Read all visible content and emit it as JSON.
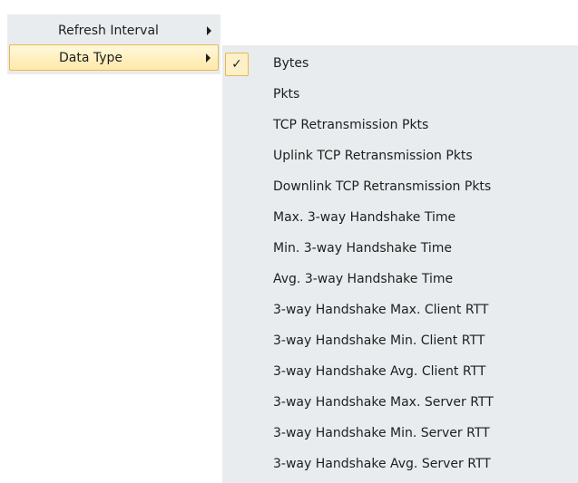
{
  "main_menu": {
    "items": [
      {
        "label": "Refresh Interval",
        "has_submenu": true,
        "highlighted": false
      },
      {
        "label": "Data Type",
        "has_submenu": true,
        "highlighted": true
      }
    ]
  },
  "data_type_menu": {
    "check_glyph": "✓",
    "selected": "Bytes",
    "items": [
      {
        "label": "Bytes",
        "checked": true
      },
      {
        "label": "Pkts",
        "checked": false
      },
      {
        "label": "TCP Retransmission Pkts",
        "checked": false
      },
      {
        "label": "Uplink TCP Retransmission Pkts",
        "checked": false
      },
      {
        "label": "Downlink TCP Retransmission Pkts",
        "checked": false
      },
      {
        "label": "Max. 3-way Handshake Time",
        "checked": false
      },
      {
        "label": "Min. 3-way Handshake Time",
        "checked": false
      },
      {
        "label": "Avg. 3-way Handshake Time",
        "checked": false
      },
      {
        "label": "3-way Handshake Max. Client RTT",
        "checked": false
      },
      {
        "label": "3-way Handshake Min. Client RTT",
        "checked": false
      },
      {
        "label": "3-way Handshake Avg. Client RTT",
        "checked": false
      },
      {
        "label": "3-way Handshake Max. Server RTT",
        "checked": false
      },
      {
        "label": "3-way Handshake Min. Server RTT",
        "checked": false
      },
      {
        "label": "3-way Handshake Avg. Server RTT",
        "checked": false
      }
    ]
  },
  "colors": {
    "menu_background": "#e9ecee",
    "highlight_border": "#e8b74d",
    "highlight_fill": "#ffe9a8"
  }
}
